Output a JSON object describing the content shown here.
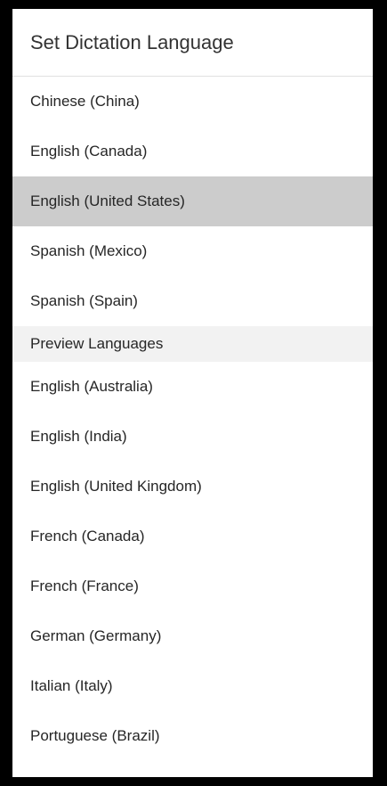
{
  "menu": {
    "title": "Set Dictation Language",
    "languages": [
      {
        "label": "Chinese (China)"
      },
      {
        "label": "English (Canada)"
      },
      {
        "label": "English (United States)",
        "selected": true
      },
      {
        "label": "Spanish (Mexico)"
      },
      {
        "label": "Spanish (Spain)"
      }
    ],
    "preview_section_label": "Preview Languages",
    "preview_languages": [
      {
        "label": "English (Australia)"
      },
      {
        "label": "English (India)"
      },
      {
        "label": "English (United Kingdom)"
      },
      {
        "label": "French (Canada)"
      },
      {
        "label": "French (France)"
      },
      {
        "label": "German (Germany)"
      },
      {
        "label": "Italian (Italy)"
      },
      {
        "label": "Portuguese (Brazil)"
      }
    ]
  },
  "colors": {
    "background": "#000000",
    "panel": "#ffffff",
    "selected_item": "#cccccc",
    "section_header": "#f2f2f2",
    "text": "#262626"
  }
}
